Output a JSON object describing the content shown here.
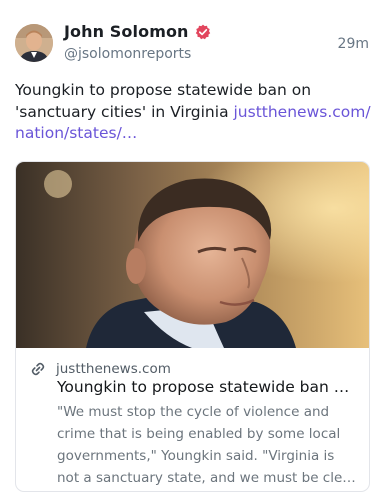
{
  "author": {
    "display_name": "John Solomon",
    "handle": "@jsolomonreports",
    "avatar_icon": "avatar-photo",
    "verified_icon": "verified-badge-icon",
    "verified_color": "#e2455d"
  },
  "post": {
    "timestamp": "29m",
    "text": "Youngkin to propose statewide ban on 'sanctuary cities' in Virginia ",
    "link_text": "justthenews.com/nation/states/…",
    "link_color": "#6a55d8"
  },
  "card": {
    "domain_icon": "link-icon",
    "domain": "justthenews.com",
    "title": "Youngkin to propose statewide ban on 'sanctuary cities' in Virginia",
    "description": "\"We must stop the cycle of violence and crime that is being enabled by some local governments,\" Youngkin said. \"Virginia is not a sanctuary state, and we must be clear that..."
  }
}
